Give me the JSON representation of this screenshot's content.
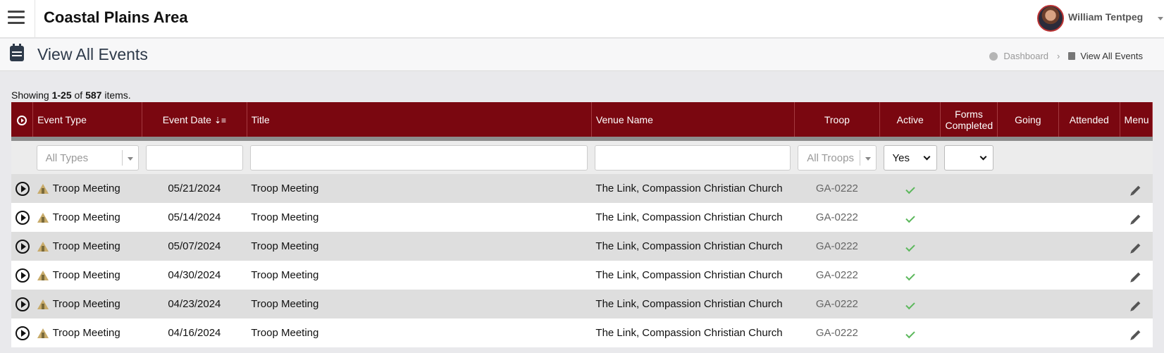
{
  "header": {
    "org_title": "Coastal Plains Area",
    "user_name": "William Tentpeg"
  },
  "page": {
    "title": "View All Events",
    "breadcrumb": {
      "dashboard": "Dashboard",
      "current": "View All Events"
    }
  },
  "summary": {
    "prefix": "Showing ",
    "range": "1-25",
    "mid": " of ",
    "total": "587",
    "suffix": " items."
  },
  "table": {
    "columns": {
      "event_type": "Event Type",
      "event_date": "Event Date",
      "title": "Title",
      "venue_name": "Venue Name",
      "troop": "Troop",
      "active": "Active",
      "forms_completed": "Forms Completed",
      "going": "Going",
      "attended": "Attended",
      "menu": "Menu"
    },
    "filters": {
      "types_placeholder": "All Types",
      "troops_placeholder": "All Troops",
      "active_value": "Yes",
      "forms_value": ""
    },
    "rows": [
      {
        "event_type": "Troop Meeting",
        "date": "05/21/2024",
        "title": "Troop Meeting",
        "venue": "The Link, Compassion Christian Church",
        "troop": "GA-0222",
        "active": true
      },
      {
        "event_type": "Troop Meeting",
        "date": "05/14/2024",
        "title": "Troop Meeting",
        "venue": "The Link, Compassion Christian Church",
        "troop": "GA-0222",
        "active": true
      },
      {
        "event_type": "Troop Meeting",
        "date": "05/07/2024",
        "title": "Troop Meeting",
        "venue": "The Link, Compassion Christian Church",
        "troop": "GA-0222",
        "active": true
      },
      {
        "event_type": "Troop Meeting",
        "date": "04/30/2024",
        "title": "Troop Meeting",
        "venue": "The Link, Compassion Christian Church",
        "troop": "GA-0222",
        "active": true
      },
      {
        "event_type": "Troop Meeting",
        "date": "04/23/2024",
        "title": "Troop Meeting",
        "venue": "The Link, Compassion Christian Church",
        "troop": "GA-0222",
        "active": true
      },
      {
        "event_type": "Troop Meeting",
        "date": "04/16/2024",
        "title": "Troop Meeting",
        "venue": "The Link, Compassion Christian Church",
        "troop": "GA-0222",
        "active": true
      }
    ]
  },
  "colors": {
    "header_maroon": "#7a0710",
    "check_green": "#5cb85c"
  }
}
